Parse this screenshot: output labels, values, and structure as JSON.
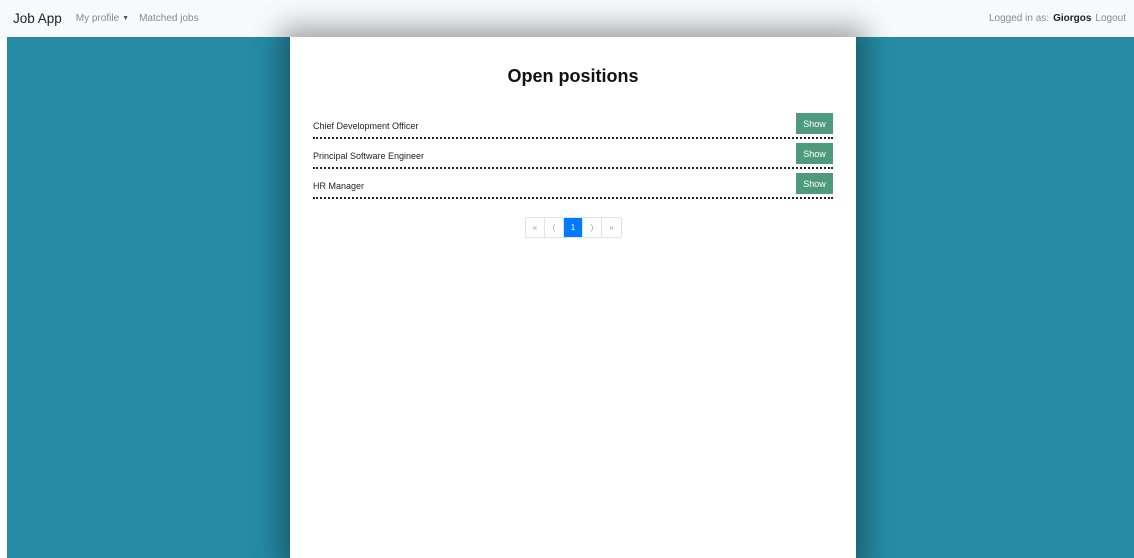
{
  "navbar": {
    "brand": "Job App",
    "my_profile": "My profile",
    "matched_jobs": "Matched jobs",
    "logged_in_label": "Logged in as:",
    "username": "Giorgos",
    "logout": "Logout"
  },
  "main": {
    "title": "Open positions",
    "jobs": [
      {
        "title": "Chief Development Officer",
        "button": "Show"
      },
      {
        "title": "Principal Software Engineer",
        "button": "Show"
      },
      {
        "title": "HR Manager",
        "button": "Show"
      }
    ],
    "pagination": {
      "first": "«",
      "prev": "(",
      "current": "1",
      "next": ")",
      "last": "»"
    }
  },
  "colors": {
    "background": "#268ba5",
    "button": "#4e9a7f",
    "active_page": "#007bff"
  }
}
